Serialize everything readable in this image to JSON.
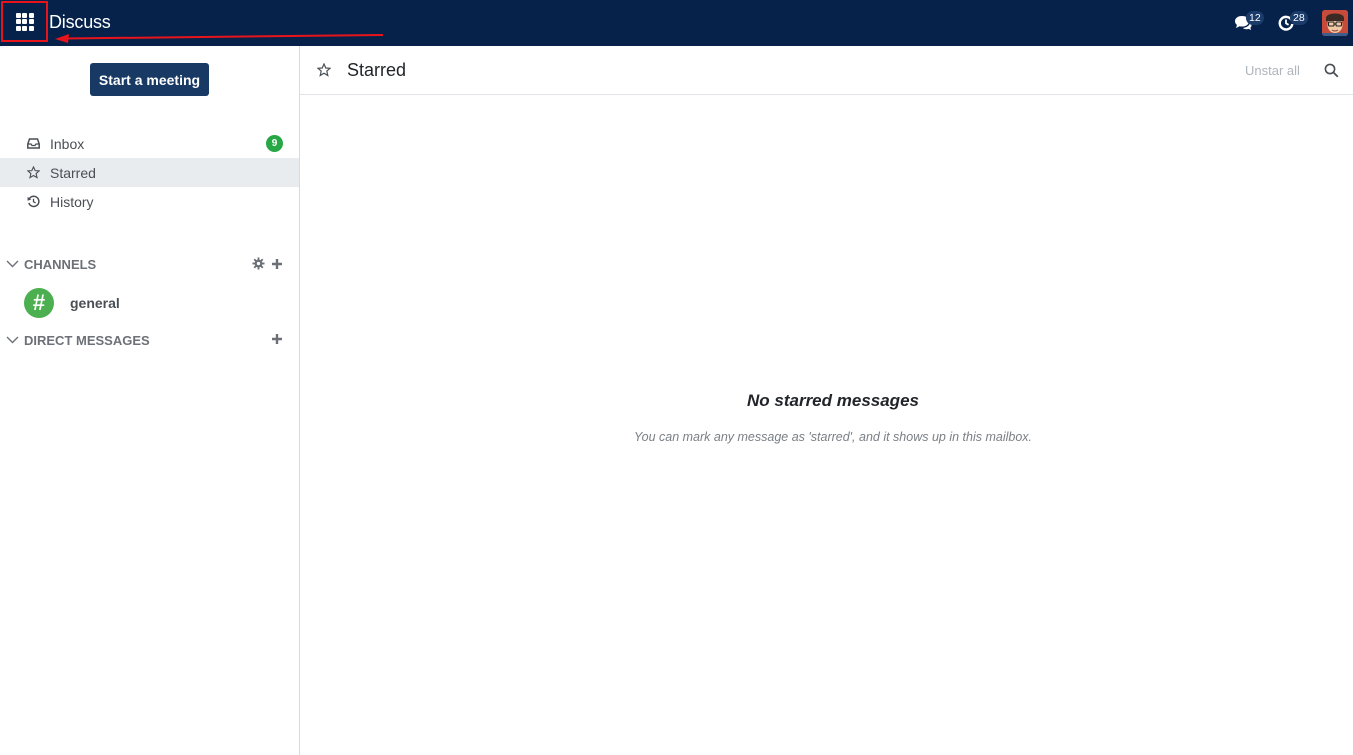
{
  "navbar": {
    "app_title": "Discuss",
    "messages_count": "12",
    "activities_count": "28",
    "apps_icon": "grid-icon",
    "bg_color": "#06224a"
  },
  "sidebar": {
    "start_meeting_label": "Start a meeting",
    "mailboxes": [
      {
        "label": "Inbox",
        "icon": "inbox-icon",
        "count": "9"
      },
      {
        "label": "Starred",
        "icon": "star-icon"
      },
      {
        "label": "History",
        "icon": "history-icon"
      }
    ],
    "channels_header": "CHANNELS",
    "channels": [
      {
        "name": "general"
      }
    ],
    "direct_messages_header": "DIRECT MESSAGES"
  },
  "thread": {
    "title": "Starred",
    "unstar_all_label": "Unstar all",
    "empty_title": "No starred messages",
    "empty_subtitle": "You can mark any message as 'starred', and it shows up in this mailbox."
  },
  "colors": {
    "primary_button": "#173964",
    "badge_green": "#28a745",
    "annotation_red": "#e8141c"
  }
}
